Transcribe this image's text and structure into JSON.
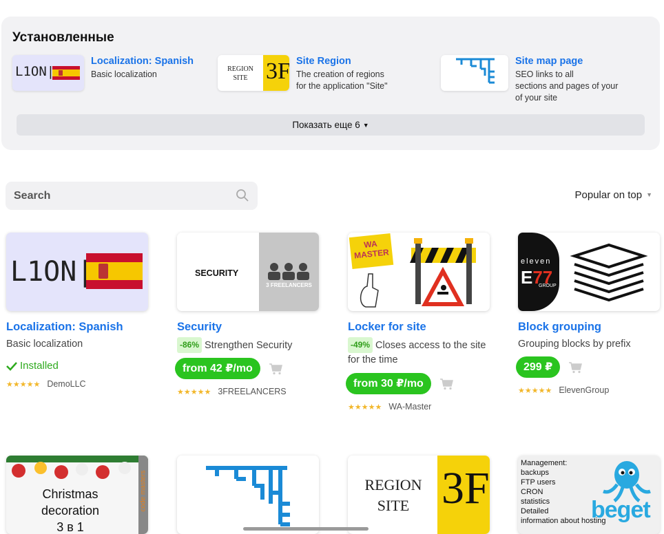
{
  "installed": {
    "heading": "Установленные",
    "items": [
      {
        "title": "Localization: Spanish",
        "desc_lines": [
          "Basic localization"
        ],
        "thumb_text": "L1ON|"
      },
      {
        "title": "Site Region",
        "desc_lines": [
          "The creation of regions",
          "for the application \"Site\""
        ],
        "thumb_text_1": "REGION",
        "thumb_text_2": "SITE",
        "logo": "3F"
      },
      {
        "title": "Site map page",
        "desc_lines": [
          "SEO links to all",
          "sections and pages of your",
          "of your  site"
        ]
      }
    ],
    "show_more": "Показать еще 6"
  },
  "search": {
    "placeholder": "Search"
  },
  "sort": {
    "label": "Popular on top"
  },
  "products": [
    {
      "title": "Localization: Spanish",
      "desc": "Basic localization",
      "status": "Installed",
      "vendor": "DemoLLC",
      "stars": "★★★★★",
      "thumb_text": "L1ON|"
    },
    {
      "title": "Security",
      "discount": "-86%",
      "desc": "Strengthen Security",
      "price": "from 42 ₽/mo",
      "vendor": "3FREELANCERS",
      "stars": "★★★★★",
      "thumb_text": "SECURITY",
      "thumb_sub": "3 FREELANCERS"
    },
    {
      "title": "Locker for site",
      "discount": "-49%",
      "desc": "Closes access to the site for the time",
      "price": "from 30 ₽/mo",
      "vendor": "WA-Master",
      "stars": "★★★★★",
      "thumb_text_1": "WA",
      "thumb_text_2": "MASTER"
    },
    {
      "title": "Block grouping",
      "desc": "Grouping blocks by prefix",
      "price": "299 ₽",
      "vendor": "ElevenGroup",
      "stars": "★★★★★",
      "thumb_text_1": "eleven",
      "thumb_text_2": "GROUP"
    }
  ],
  "row2": [
    {
      "line1": "Christmas",
      "line2": "decoration",
      "line3": "3 в 1",
      "side": "code masters"
    },
    {},
    {
      "line1": "REGION",
      "line2": "SITE",
      "logo": "3F"
    },
    {
      "lines": [
        "Management:",
        "backups",
        "FTP users",
        "CRON",
        "statistics",
        "Detailed",
        "information about hosting"
      ],
      "brand": "beget"
    }
  ],
  "colors": {
    "link": "#1a73e8",
    "price": "#2ac41f",
    "installed": "#2eaa1e",
    "star": "#f2b72b"
  }
}
